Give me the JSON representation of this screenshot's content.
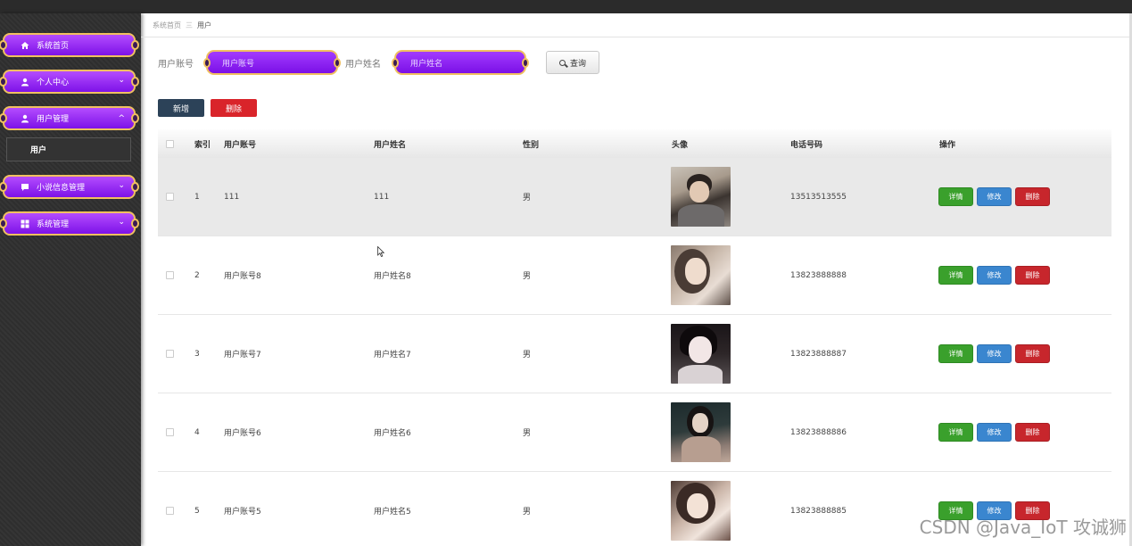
{
  "sidebar": {
    "items": [
      {
        "label": "系统首页",
        "icon": "home-icon"
      },
      {
        "label": "个人中心",
        "icon": "person-icon"
      },
      {
        "label": "用户管理",
        "icon": "person-icon"
      },
      {
        "label": "小说信息管理",
        "icon": "chat-icon"
      },
      {
        "label": "系统管理",
        "icon": "grid-icon"
      }
    ],
    "sub_item": "用户"
  },
  "breadcrumb": {
    "home": "系统首页",
    "separator": "三",
    "current": "用户"
  },
  "search": {
    "account_label": "用户账号",
    "account_placeholder": "用户账号",
    "name_label": "用户姓名",
    "name_placeholder": "用户姓名",
    "query_label": "查询"
  },
  "toolbar": {
    "add_label": "新增",
    "delete_label": "删除"
  },
  "table": {
    "headers": {
      "index": "索引",
      "account": "用户账号",
      "name": "用户姓名",
      "gender": "性别",
      "avatar": "头像",
      "phone": "电话号码",
      "actions": "操作"
    },
    "rows": [
      {
        "index": "1",
        "account": "111",
        "name": "111",
        "gender": "男",
        "phone": "13513513555"
      },
      {
        "index": "2",
        "account": "用户账号8",
        "name": "用户姓名8",
        "gender": "男",
        "phone": "13823888888"
      },
      {
        "index": "3",
        "account": "用户账号7",
        "name": "用户姓名7",
        "gender": "男",
        "phone": "13823888887"
      },
      {
        "index": "4",
        "account": "用户账号6",
        "name": "用户姓名6",
        "gender": "男",
        "phone": "13823888886"
      },
      {
        "index": "5",
        "account": "用户账号5",
        "name": "用户姓名5",
        "gender": "男",
        "phone": "13823888885"
      }
    ],
    "actions": {
      "detail": "详情",
      "edit": "修改",
      "remove": "删除"
    }
  },
  "watermark": "CSDN @Java_IoT 攻诚狮"
}
